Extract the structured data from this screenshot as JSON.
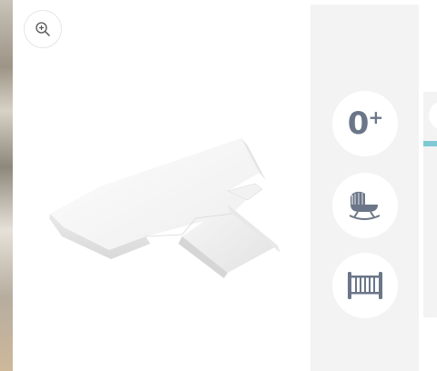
{
  "gallery": {
    "zoom_icon": "zoom-in-icon",
    "product_image": "white-wedge-pillow"
  },
  "badges": {
    "age": {
      "value": "0",
      "suffix": "+"
    },
    "cradle_icon": "cradle-icon",
    "crib_icon": "crib-icon"
  },
  "colors": {
    "badge_icon": "#6b7688",
    "accent": "#7fc9d4",
    "panel_bg": "#f3f3f3"
  }
}
